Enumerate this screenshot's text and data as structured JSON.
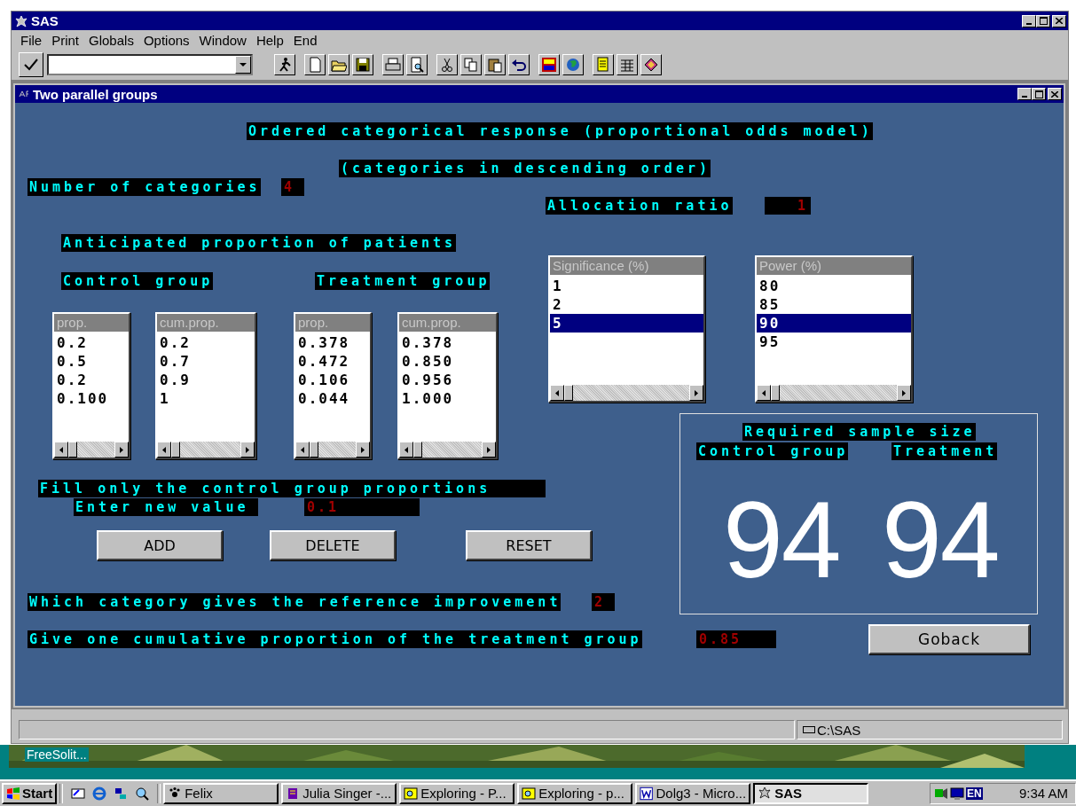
{
  "window": {
    "title": "SAS"
  },
  "menu": [
    "File",
    "Print",
    "Globals",
    "Options",
    "Window",
    "Help",
    "End"
  ],
  "form": {
    "title": "Two parallel groups",
    "heading": "Ordered categorical response (proportional odds model)",
    "subheading": "(categories in descending order)",
    "categories": {
      "label": "Number of categories",
      "value": "4"
    },
    "allocation": {
      "label": "Allocation ratio",
      "value": "1"
    },
    "anticipated_label": "Anticipated proportion of patients",
    "control_label": "Control group",
    "treatment_label": "Treatment group",
    "lists": [
      {
        "header": "prop.",
        "items": [
          {
            "text": "0.2",
            "selected": false
          },
          {
            "text": "0.5",
            "selected": false
          },
          {
            "text": "0.2",
            "selected": false
          },
          {
            "text": "0.100",
            "selected": false
          }
        ]
      },
      {
        "header": "cum.prop.",
        "items": [
          {
            "text": "0.2",
            "selected": false
          },
          {
            "text": "0.7",
            "selected": false
          },
          {
            "text": "0.9",
            "selected": false
          },
          {
            "text": "1",
            "selected": false
          }
        ]
      },
      {
        "header": "prop.",
        "items": [
          {
            "text": "0.378",
            "selected": false
          },
          {
            "text": "0.472",
            "selected": false
          },
          {
            "text": "0.106",
            "selected": false
          },
          {
            "text": "0.044",
            "selected": false
          }
        ]
      },
      {
        "header": "cum.prop.",
        "items": [
          {
            "text": "0.378",
            "selected": false
          },
          {
            "text": "0.850",
            "selected": false
          },
          {
            "text": "0.956",
            "selected": false
          },
          {
            "text": "1.000",
            "selected": false
          }
        ]
      },
      {
        "header": "Significance (%)",
        "items": [
          {
            "text": "1",
            "selected": false
          },
          {
            "text": "2",
            "selected": false
          },
          {
            "text": "5",
            "selected": true
          }
        ]
      },
      {
        "header": "Power (%)",
        "items": [
          {
            "text": "80",
            "selected": false
          },
          {
            "text": "85",
            "selected": false
          },
          {
            "text": "90",
            "selected": true
          },
          {
            "text": "95",
            "selected": false
          }
        ]
      }
    ],
    "hint": "Fill only the control group proportions",
    "new_value": {
      "label": "Enter new value",
      "value": "0.1"
    },
    "buttons": [
      "ADD",
      "DELETE",
      "RESET"
    ],
    "reference": {
      "label": "Which category gives the reference improvement",
      "value": "2"
    },
    "cumulative": {
      "label": "Give one cumulative proportion of the treatment group",
      "value": "0.85"
    },
    "result": {
      "title": "Required sample size",
      "columns": [
        {
          "label": "Control group",
          "value": "94"
        },
        {
          "label": "Treatment",
          "value": "94"
        }
      ]
    },
    "goback": "Goback"
  },
  "status_bar": {
    "path": "C:\\SAS"
  },
  "desktop": {
    "icon_label": "FreeSolit..."
  },
  "taskbar": {
    "start": "Start",
    "tasks": [
      {
        "label": "Felix",
        "selected": false
      },
      {
        "label": "Julia Singer -...",
        "selected": false
      },
      {
        "label": "Exploring - P...",
        "selected": false
      },
      {
        "label": "Exploring - p...",
        "selected": false
      },
      {
        "label": "Dolg3 - Micro...",
        "selected": false
      },
      {
        "label": "SAS",
        "selected": true
      }
    ],
    "language": "EN",
    "clock": "9:34 AM"
  }
}
